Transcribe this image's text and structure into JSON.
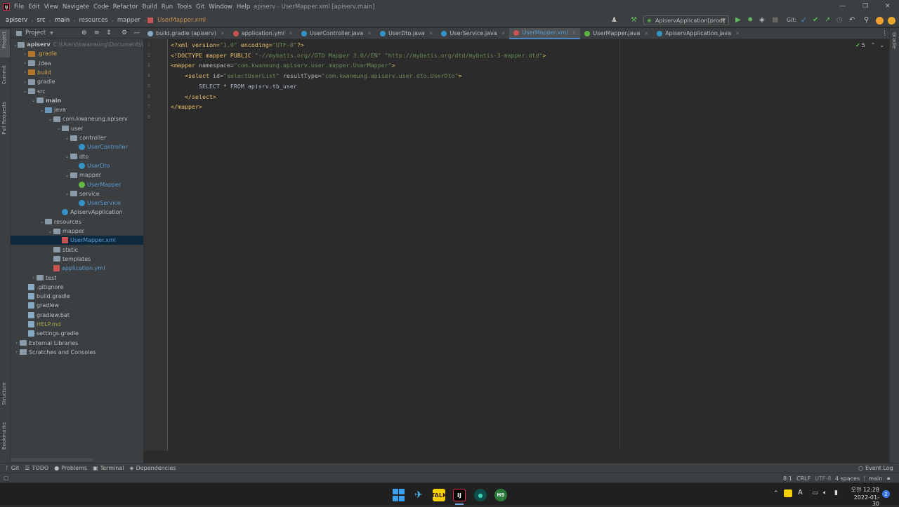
{
  "window": {
    "title": "apiserv - UserMapper.xml [apiserv.main]"
  },
  "menu": [
    "File",
    "Edit",
    "View",
    "Navigate",
    "Code",
    "Refactor",
    "Build",
    "Run",
    "Tools",
    "Git",
    "Window",
    "Help"
  ],
  "breadcrumb": [
    "apiserv",
    "src",
    "main",
    "resources",
    "mapper",
    "UserMapper.xml"
  ],
  "toolbar": {
    "run_config": "ApiservApplication[prod]",
    "git_label": "Git:"
  },
  "project_panel": {
    "title": "Project"
  },
  "left_strip": [
    "Project",
    "Commit",
    "Pull Requests",
    "Structure",
    "Bookmarks"
  ],
  "right_strip": [
    "Gradle"
  ],
  "tree": [
    {
      "label": "apiserv",
      "suffix": "C:\\Users\\kwaneung\\Documents\\",
      "depth": 0,
      "kind": "folder"
    },
    {
      "label": ".gradle",
      "depth": 1,
      "kind": "folder-orange"
    },
    {
      "label": ".idea",
      "depth": 1,
      "kind": "folder"
    },
    {
      "label": "build",
      "depth": 1,
      "kind": "folder-orange"
    },
    {
      "label": "gradle",
      "depth": 1,
      "kind": "folder"
    },
    {
      "label": "src",
      "depth": 1,
      "kind": "folder"
    },
    {
      "label": "main",
      "depth": 2,
      "kind": "folder"
    },
    {
      "label": "java",
      "depth": 3,
      "kind": "folder-blue"
    },
    {
      "label": "com.kwaneung.apiserv",
      "depth": 4,
      "kind": "folder"
    },
    {
      "label": "user",
      "depth": 5,
      "kind": "folder"
    },
    {
      "label": "controller",
      "depth": 6,
      "kind": "folder"
    },
    {
      "label": "UserController",
      "depth": 7,
      "kind": "class"
    },
    {
      "label": "dto",
      "depth": 6,
      "kind": "folder"
    },
    {
      "label": "UserDto",
      "depth": 7,
      "kind": "class"
    },
    {
      "label": "mapper",
      "depth": 6,
      "kind": "folder"
    },
    {
      "label": "UserMapper",
      "depth": 7,
      "kind": "interface"
    },
    {
      "label": "service",
      "depth": 6,
      "kind": "folder"
    },
    {
      "label": "UserService",
      "depth": 7,
      "kind": "class"
    },
    {
      "label": "ApiservApplication",
      "depth": 5,
      "kind": "class-plain"
    },
    {
      "label": "resources",
      "depth": 3,
      "kind": "folder"
    },
    {
      "label": "mapper",
      "depth": 4,
      "kind": "folder"
    },
    {
      "label": "UserMapper.xml",
      "depth": 5,
      "kind": "xml"
    },
    {
      "label": "static",
      "depth": 4,
      "kind": "folder"
    },
    {
      "label": "templates",
      "depth": 4,
      "kind": "folder"
    },
    {
      "label": "application.yml",
      "depth": 4,
      "kind": "yml"
    },
    {
      "label": "test",
      "depth": 2,
      "kind": "folder"
    },
    {
      "label": ".gitignore",
      "depth": 1,
      "kind": "file"
    },
    {
      "label": "build.gradle",
      "depth": 1,
      "kind": "file"
    },
    {
      "label": "gradlew",
      "depth": 1,
      "kind": "file"
    },
    {
      "label": "gradlew.bat",
      "depth": 1,
      "kind": "file"
    },
    {
      "label": "HELP.md",
      "depth": 1,
      "kind": "md"
    },
    {
      "label": "settings.gradle",
      "depth": 1,
      "kind": "file"
    },
    {
      "label": "External Libraries",
      "depth": 0,
      "kind": "lib"
    },
    {
      "label": "Scratches and Consoles",
      "depth": 0,
      "kind": "lib"
    }
  ],
  "tabs": [
    {
      "label": "build.gradle (apiserv)",
      "color": "#86a9c4"
    },
    {
      "label": "application.yml",
      "color": "#c75450"
    },
    {
      "label": "UserController.java",
      "color": "#3592c4"
    },
    {
      "label": "UserDto.java",
      "color": "#3592c4"
    },
    {
      "label": "UserService.java",
      "color": "#3592c4"
    },
    {
      "label": "UserMapper.xml",
      "color": "#c75450",
      "active": true
    },
    {
      "label": "UserMapper.java",
      "color": "#62b543"
    },
    {
      "label": "ApiservApplication.java",
      "color": "#3592c4"
    }
  ],
  "editor": {
    "line_numbers": [
      "1",
      "2",
      "3",
      "4",
      "5",
      "6",
      "7",
      "8"
    ],
    "inspection_count": "5",
    "lines": [
      [
        [
          "<?xml version=",
          "kw"
        ],
        [
          "\"1.0\"",
          "av"
        ],
        [
          " encoding=",
          "kw"
        ],
        [
          "\"UTF-8\"",
          "av"
        ],
        [
          "?>",
          "kw"
        ]
      ],
      [
        [
          "<!DOCTYPE mapper PUBLIC ",
          "kw"
        ],
        [
          "\"-//mybatis.org//DTD Mapper 3.0//EN\"",
          "av"
        ],
        [
          " ",
          "pl"
        ],
        [
          "\"http://mybatis.org/dtd/mybatis-3-mapper.dtd\"",
          "av"
        ],
        [
          ">",
          "kw"
        ]
      ],
      [
        [
          "<mapper ",
          "kw"
        ],
        [
          "namespace=",
          "at"
        ],
        [
          "\"com.kwaneung.apiserv.user.mapper.UserMapper\"",
          "av"
        ],
        [
          ">",
          "kw"
        ]
      ],
      [
        [
          "    <select ",
          "kw"
        ],
        [
          "id=",
          "at"
        ],
        [
          "\"selectUserList\"",
          "av"
        ],
        [
          " resultType=",
          "at"
        ],
        [
          "\"com.kwaneung.apiserv.user.dto.UserDto\"",
          "av"
        ],
        [
          ">",
          "kw"
        ]
      ],
      [
        [
          "        SELECT * FROM apisrv.tb_user",
          "pl"
        ]
      ],
      [
        [
          "    </select>",
          "kw"
        ]
      ],
      [
        [
          "</mapper>",
          "kw"
        ]
      ],
      [
        [
          "",
          "pl"
        ]
      ]
    ]
  },
  "bottom_tabs": [
    "Git",
    "TODO",
    "Problems",
    "Terminal",
    "Dependencies"
  ],
  "event_log": "Event Log",
  "status": {
    "position": "8:1",
    "line_sep": "CRLF",
    "encoding": "UTF-8",
    "indent": "4 spaces",
    "branch": "main"
  },
  "taskbar": {
    "time": "12:28",
    "ampm": "오전",
    "date": "2022-01-30",
    "notif": "2",
    "lang": "A"
  }
}
